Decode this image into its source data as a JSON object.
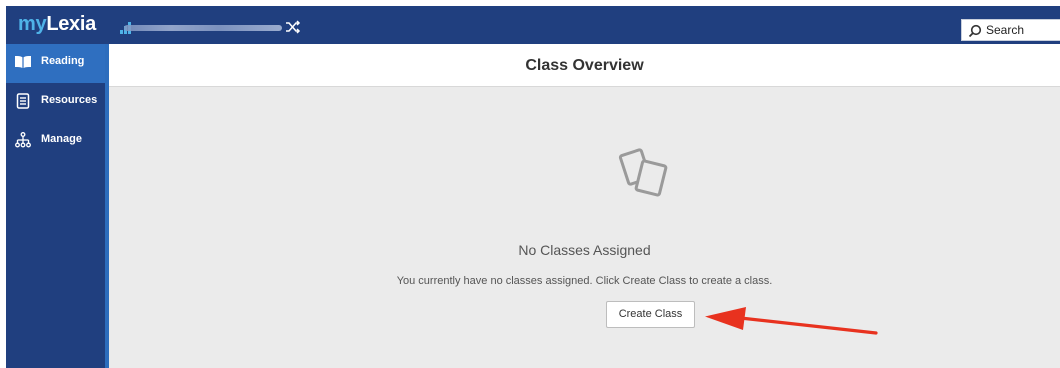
{
  "header": {
    "logo_my": "my",
    "logo_lexia": "Lexia",
    "search_label": "Search"
  },
  "sidebar": {
    "items": [
      {
        "label": "Reading",
        "icon": "book-icon",
        "active": true
      },
      {
        "label": "Resources",
        "icon": "document-icon",
        "active": false
      },
      {
        "label": "Manage",
        "icon": "hierarchy-icon",
        "active": false
      }
    ]
  },
  "main": {
    "title": "Class Overview",
    "empty_icon": "cards-icon",
    "empty_title": "No Classes Assigned",
    "empty_description": "You currently have no classes assigned. Click Create Class to create a class.",
    "create_button": "Create Class"
  },
  "colors": {
    "navbar": "#203f7f",
    "sidebar_active": "#2f6fc0",
    "logo_accent": "#4fb3e8",
    "content_bg": "#ebebeb",
    "annotation_arrow": "#e8321f"
  }
}
